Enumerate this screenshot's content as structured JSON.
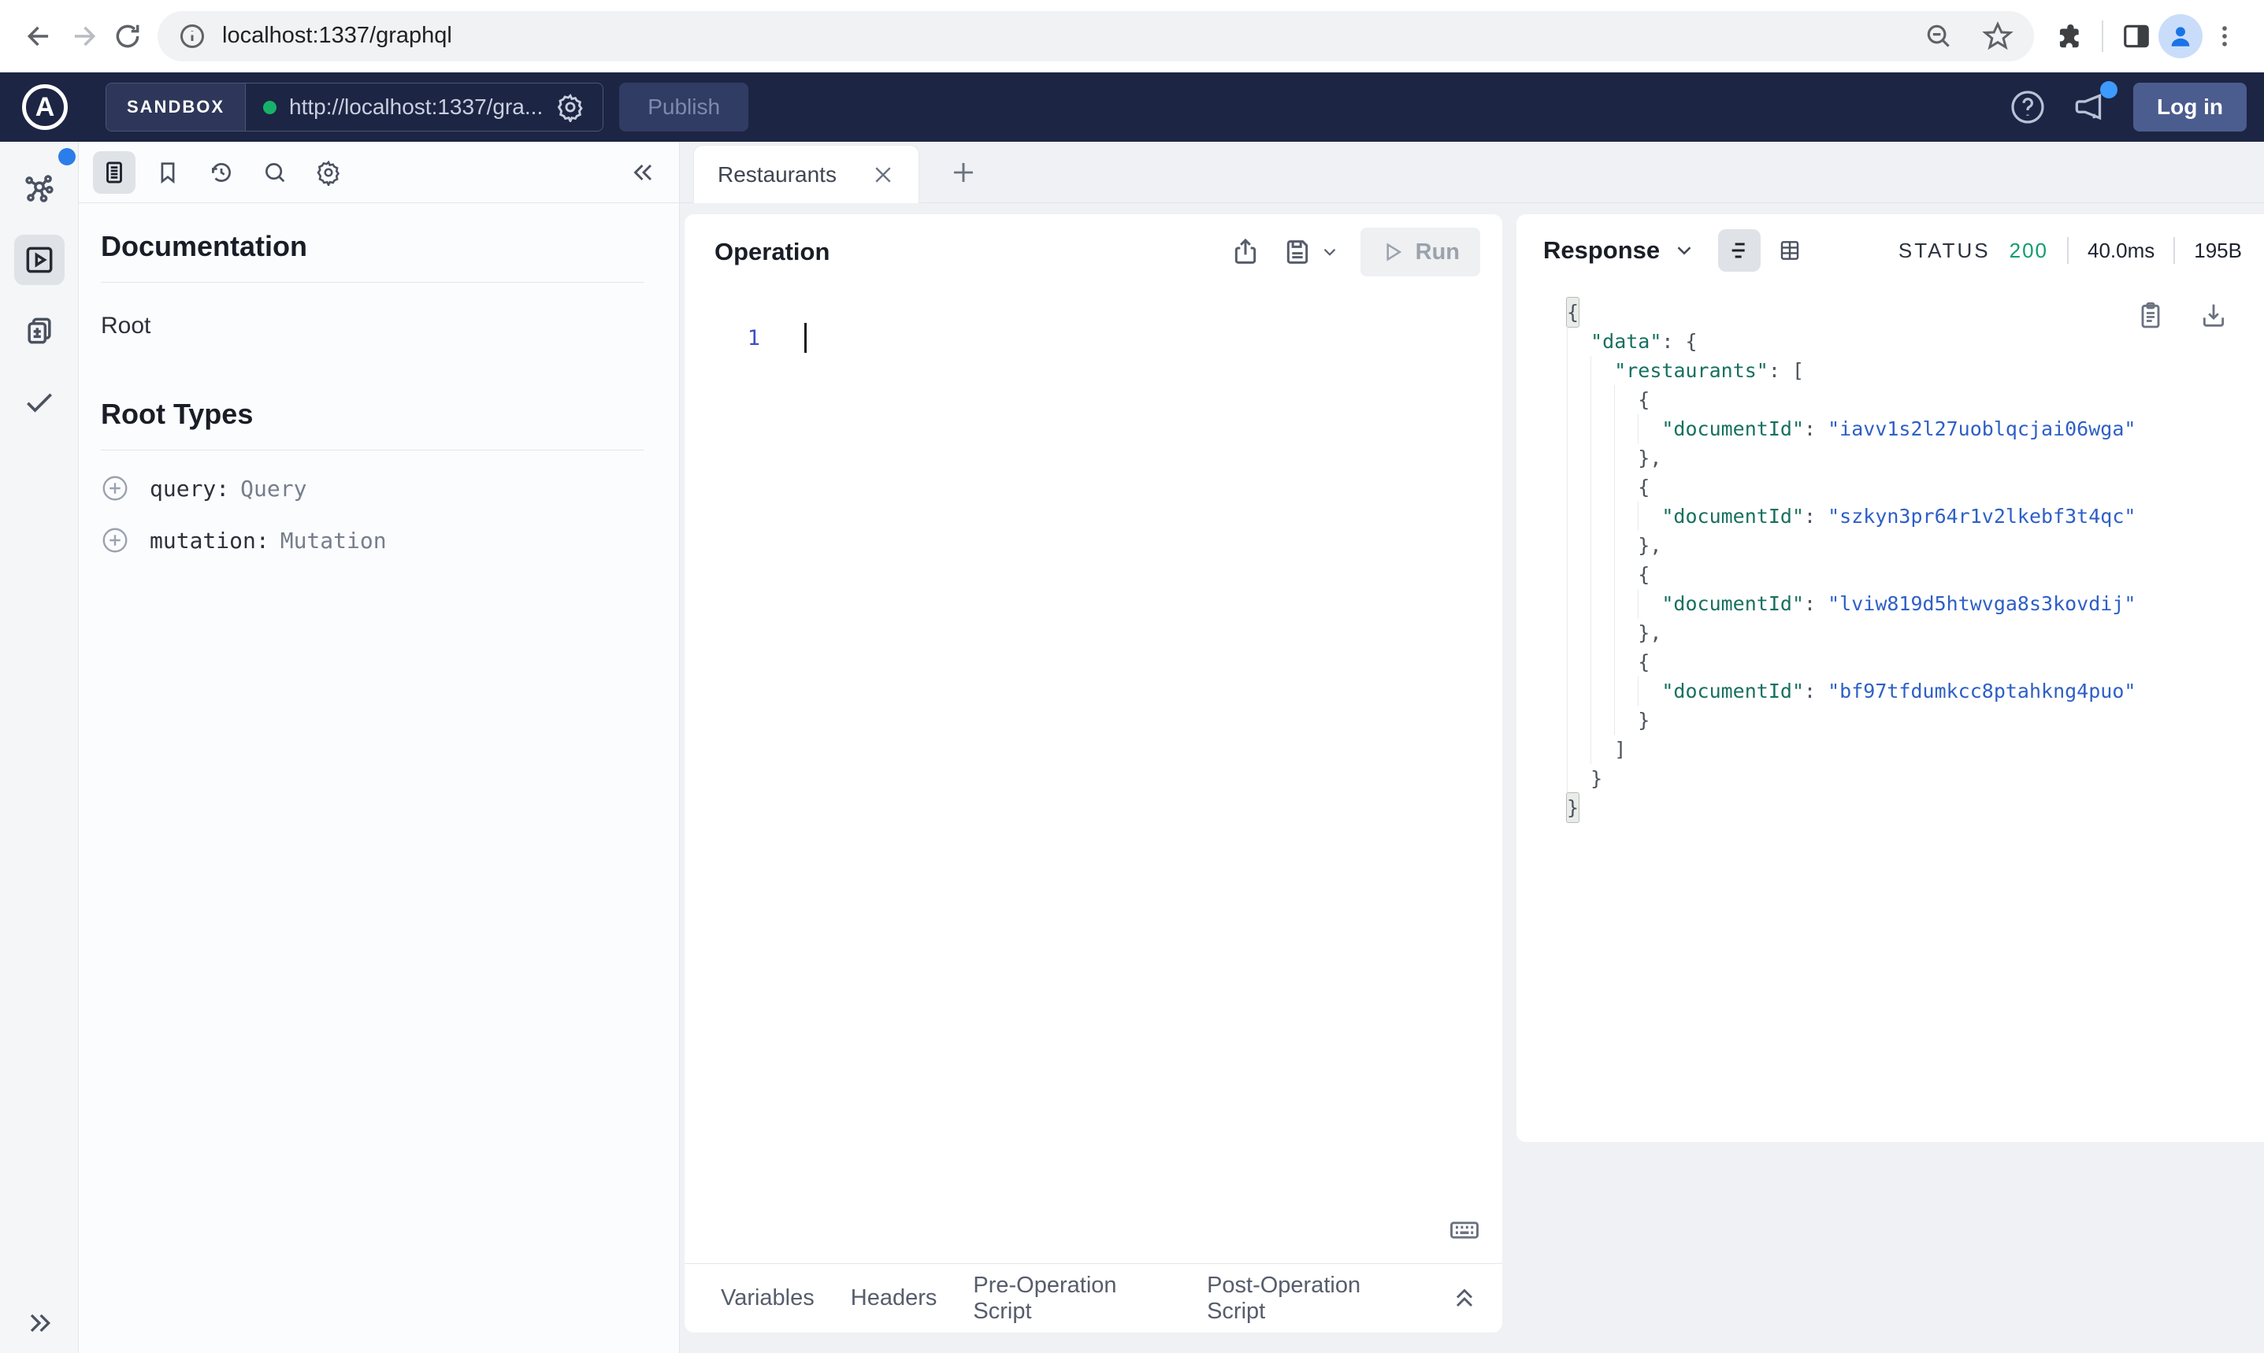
{
  "browser": {
    "url": "localhost:1337/graphql",
    "icons": [
      "back-arrow",
      "forward-arrow",
      "reload",
      "info",
      "zoom-out",
      "bookmark-star",
      "extensions-puzzle",
      "side-panel",
      "profile-avatar",
      "kebab-menu"
    ]
  },
  "app_header": {
    "brand": "SANDBOX",
    "endpoint": "http://localhost:1337/gra...",
    "publish_label": "Publish",
    "login_label": "Log in",
    "icons": [
      "apollo-logo",
      "gear",
      "help-circle",
      "megaphone"
    ]
  },
  "rail_icons": [
    "schema-graph",
    "explorer-play",
    "changesets-diff",
    "checklist",
    "expand-double-chevron"
  ],
  "docs": {
    "title": "Documentation",
    "root_link": "Root",
    "section_title": "Root Types",
    "root_types": [
      {
        "field": "query:",
        "type": "Query"
      },
      {
        "field": "mutation:",
        "type": "Mutation"
      }
    ],
    "toolbar_icons": [
      "documentation",
      "bookmark",
      "history",
      "search",
      "settings-gear",
      "collapse-double-chevron"
    ]
  },
  "tabs": {
    "active": "Restaurants"
  },
  "operation": {
    "title": "Operation",
    "run_label": "Run",
    "line_number": "1",
    "icons": [
      "share",
      "save-disk",
      "chevron-down",
      "play-triangle",
      "keyboard-shortcuts"
    ]
  },
  "response": {
    "title": "Response",
    "status_label": "STATUS",
    "status_code": "200",
    "duration": "40.0ms",
    "size": "195B",
    "icons": [
      "chevron-down",
      "format-lines",
      "table-view",
      "copy-clipboard",
      "download"
    ],
    "json_lines": [
      {
        "i": 0,
        "s": [
          [
            "ph",
            "{"
          ]
        ]
      },
      {
        "i": 1,
        "s": [
          [
            "k",
            "\"data\""
          ],
          [
            "p",
            ": {"
          ]
        ]
      },
      {
        "i": 2,
        "s": [
          [
            "k",
            "\"restaurants\""
          ],
          [
            "p",
            ": ["
          ]
        ]
      },
      {
        "i": 3,
        "s": [
          [
            "p",
            "{"
          ]
        ]
      },
      {
        "i": 4,
        "s": [
          [
            "k",
            "\"documentId\""
          ],
          [
            "p",
            ": "
          ],
          [
            "v",
            "\"iavv1s2l27uoblqcjai06wga\""
          ]
        ]
      },
      {
        "i": 3,
        "s": [
          [
            "p",
            "},"
          ]
        ]
      },
      {
        "i": 3,
        "s": [
          [
            "p",
            "{"
          ]
        ]
      },
      {
        "i": 4,
        "s": [
          [
            "k",
            "\"documentId\""
          ],
          [
            "p",
            ": "
          ],
          [
            "v",
            "\"szkyn3pr64r1v2lkebf3t4qc\""
          ]
        ]
      },
      {
        "i": 3,
        "s": [
          [
            "p",
            "},"
          ]
        ]
      },
      {
        "i": 3,
        "s": [
          [
            "p",
            "{"
          ]
        ]
      },
      {
        "i": 4,
        "s": [
          [
            "k",
            "\"documentId\""
          ],
          [
            "p",
            ": "
          ],
          [
            "v",
            "\"lviw819d5htwvga8s3kovdij\""
          ]
        ]
      },
      {
        "i": 3,
        "s": [
          [
            "p",
            "},"
          ]
        ]
      },
      {
        "i": 3,
        "s": [
          [
            "p",
            "{"
          ]
        ]
      },
      {
        "i": 4,
        "s": [
          [
            "k",
            "\"documentId\""
          ],
          [
            "p",
            ": "
          ],
          [
            "v",
            "\"bf97tfdumkcc8ptahkng4puo\""
          ]
        ]
      },
      {
        "i": 3,
        "s": [
          [
            "p",
            "}"
          ]
        ]
      },
      {
        "i": 2,
        "s": [
          [
            "p",
            "]"
          ]
        ]
      },
      {
        "i": 1,
        "s": [
          [
            "p",
            "}"
          ]
        ]
      },
      {
        "i": 0,
        "s": [
          [
            "ph",
            "}"
          ]
        ]
      }
    ]
  },
  "bottom_tabs": [
    "Variables",
    "Headers",
    "Pre-Operation Script",
    "Post-Operation Script"
  ],
  "colors": {
    "header_navy": "#1c2543",
    "status_green": "#0d9e6d",
    "json_key_teal": "#17705f",
    "json_value_blue": "#2e5fc7",
    "accent_blue_dot": "#2b7de9"
  }
}
